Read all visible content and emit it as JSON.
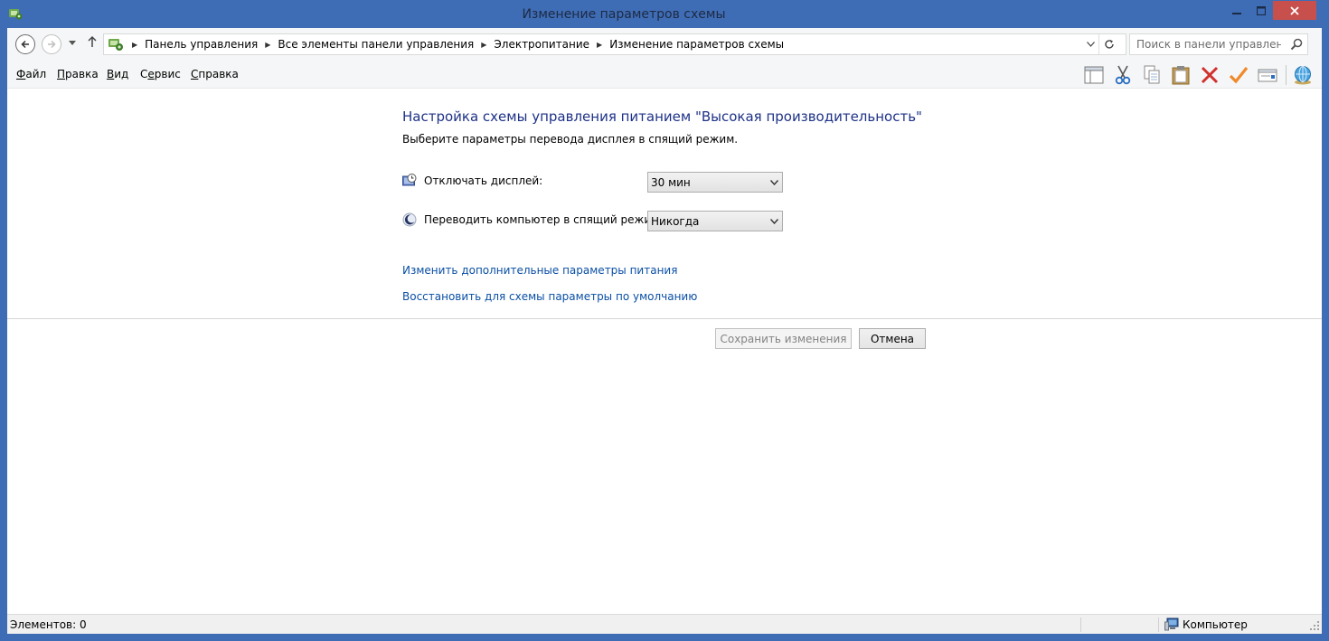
{
  "window": {
    "title": "Изменение параметров схемы"
  },
  "address": {
    "breadcrumbs": [
      "Панель управления",
      "Все элементы панели управления",
      "Электропитание",
      "Изменение параметров схемы"
    ]
  },
  "search": {
    "placeholder": "Поиск в панели управления"
  },
  "menu": {
    "file": {
      "accel": "Ф",
      "rest": "айл"
    },
    "edit": {
      "accel": "П",
      "rest": "равка"
    },
    "view": {
      "accel": "В",
      "rest": "ид"
    },
    "tools": {
      "pre": "С",
      "accel": "е",
      "rest": "рвис"
    },
    "help": {
      "accel": "С",
      "rest": "правка"
    }
  },
  "toolbar_icons": [
    "layout-icon",
    "cut-icon",
    "copy-icon",
    "paste-icon",
    "delete-icon",
    "check-icon",
    "properties-icon",
    "globe-icon"
  ],
  "main": {
    "heading": "Настройка схемы управления питанием \"Высокая производительность\"",
    "subheading": "Выберите параметры перевода дисплея в спящий режим.",
    "display_off": {
      "label": "Отключать дисплей:",
      "value": "30 мин"
    },
    "sleep": {
      "label": "Переводить компьютер в спящий режим:",
      "value": "Никогда"
    },
    "link_advanced": "Изменить дополнительные параметры питания",
    "link_restore": "Восстановить для схемы параметры по умолчанию",
    "save_label": "Сохранить изменения",
    "cancel_label": "Отмена"
  },
  "status": {
    "items": "Элементов: 0",
    "location": "Компьютер"
  },
  "colors": {
    "frame": "#3f6db5",
    "close": "#c7504c",
    "heading": "#1e3287",
    "link": "#0a4fa5"
  }
}
